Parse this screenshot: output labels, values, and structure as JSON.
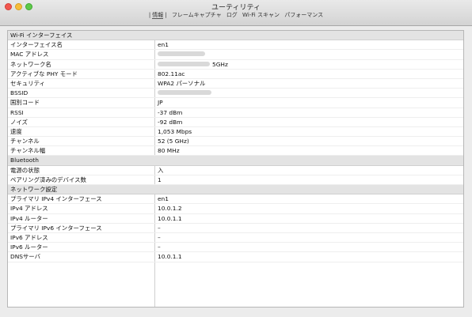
{
  "window": {
    "title": "ユーティリティ",
    "menu": [
      "情報",
      "フレームキャプチャ",
      "ログ",
      "Wi-Fi スキャン",
      "パフォーマンス"
    ]
  },
  "sections": [
    {
      "title": "Wi-Fi インターフェイス",
      "rows": [
        {
          "label": "インターフェイス名",
          "value": "en1"
        },
        {
          "label": "MAC アドレス",
          "value": ""
        },
        {
          "label": "ネットワーク名",
          "value": "5GHz"
        },
        {
          "label": "アクティブな PHY モード",
          "value": "802.11ac"
        },
        {
          "label": "セキュリティ",
          "value": "WPA2 パーソナル"
        },
        {
          "label": "BSSID",
          "value": ""
        },
        {
          "label": "国別コード",
          "value": "JP"
        },
        {
          "label": "RSSI",
          "value": "-37 dBm"
        },
        {
          "label": "ノイズ",
          "value": "-92 dBm"
        },
        {
          "label": "速度",
          "value": "1,053 Mbps"
        },
        {
          "label": "チャンネル",
          "value": "52 (5 GHz)"
        },
        {
          "label": "チャンネル幅",
          "value": "80 MHz"
        }
      ]
    },
    {
      "title": "Bluetooth",
      "rows": [
        {
          "label": "電源の状態",
          "value": "入"
        },
        {
          "label": "ペアリング済みのデバイス数",
          "value": "1"
        }
      ]
    },
    {
      "title": "ネットワーク設定",
      "rows": [
        {
          "label": "プライマリ IPv4 インターフェース",
          "value": "en1"
        },
        {
          "label": "IPv4 アドレス",
          "value": "10.0.1.2"
        },
        {
          "label": "IPv4 ルーター",
          "value": "10.0.1.1"
        },
        {
          "label": "プライマリ IPv6 インターフェース",
          "value": "–"
        },
        {
          "label": "IPv6 アドレス",
          "value": "–"
        },
        {
          "label": "IPv6 ルーター",
          "value": "–"
        },
        {
          "label": "DNSサーバ",
          "value": "10.0.1.1"
        }
      ]
    }
  ]
}
